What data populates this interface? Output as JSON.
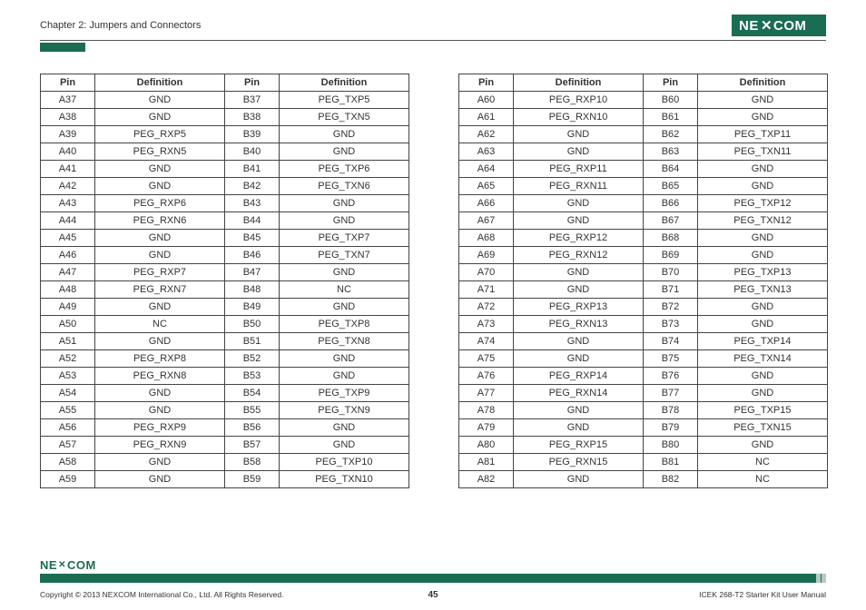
{
  "header": {
    "chapter": "Chapter 2: Jumpers and Connectors",
    "logo_text": "NEXCOM"
  },
  "columns": {
    "pin": "Pin",
    "definition": "Definition"
  },
  "table_left": [
    {
      "pa": "A37",
      "da": "GND",
      "pb": "B37",
      "db": "PEG_TXP5"
    },
    {
      "pa": "A38",
      "da": "GND",
      "pb": "B38",
      "db": "PEG_TXN5"
    },
    {
      "pa": "A39",
      "da": "PEG_RXP5",
      "pb": "B39",
      "db": "GND"
    },
    {
      "pa": "A40",
      "da": "PEG_RXN5",
      "pb": "B40",
      "db": "GND"
    },
    {
      "pa": "A41",
      "da": "GND",
      "pb": "B41",
      "db": "PEG_TXP6"
    },
    {
      "pa": "A42",
      "da": "GND",
      "pb": "B42",
      "db": "PEG_TXN6"
    },
    {
      "pa": "A43",
      "da": "PEG_RXP6",
      "pb": "B43",
      "db": "GND"
    },
    {
      "pa": "A44",
      "da": "PEG_RXN6",
      "pb": "B44",
      "db": "GND"
    },
    {
      "pa": "A45",
      "da": "GND",
      "pb": "B45",
      "db": "PEG_TXP7"
    },
    {
      "pa": "A46",
      "da": "GND",
      "pb": "B46",
      "db": "PEG_TXN7"
    },
    {
      "pa": "A47",
      "da": "PEG_RXP7",
      "pb": "B47",
      "db": "GND"
    },
    {
      "pa": "A48",
      "da": "PEG_RXN7",
      "pb": "B48",
      "db": "NC"
    },
    {
      "pa": "A49",
      "da": "GND",
      "pb": "B49",
      "db": "GND"
    },
    {
      "pa": "A50",
      "da": "NC",
      "pb": "B50",
      "db": "PEG_TXP8"
    },
    {
      "pa": "A51",
      "da": "GND",
      "pb": "B51",
      "db": "PEG_TXN8"
    },
    {
      "pa": "A52",
      "da": "PEG_RXP8",
      "pb": "B52",
      "db": "GND"
    },
    {
      "pa": "A53",
      "da": "PEG_RXN8",
      "pb": "B53",
      "db": "GND"
    },
    {
      "pa": "A54",
      "da": "GND",
      "pb": "B54",
      "db": "PEG_TXP9"
    },
    {
      "pa": "A55",
      "da": "GND",
      "pb": "B55",
      "db": "PEG_TXN9"
    },
    {
      "pa": "A56",
      "da": "PEG_RXP9",
      "pb": "B56",
      "db": "GND"
    },
    {
      "pa": "A57",
      "da": "PEG_RXN9",
      "pb": "B57",
      "db": "GND"
    },
    {
      "pa": "A58",
      "da": "GND",
      "pb": "B58",
      "db": "PEG_TXP10"
    },
    {
      "pa": "A59",
      "da": "GND",
      "pb": "B59",
      "db": "PEG_TXN10"
    }
  ],
  "table_right": [
    {
      "pa": "A60",
      "da": "PEG_RXP10",
      "pb": "B60",
      "db": "GND"
    },
    {
      "pa": "A61",
      "da": "PEG_RXN10",
      "pb": "B61",
      "db": "GND"
    },
    {
      "pa": "A62",
      "da": "GND",
      "pb": "B62",
      "db": "PEG_TXP11"
    },
    {
      "pa": "A63",
      "da": "GND",
      "pb": "B63",
      "db": "PEG_TXN11"
    },
    {
      "pa": "A64",
      "da": "PEG_RXP11",
      "pb": "B64",
      "db": "GND"
    },
    {
      "pa": "A65",
      "da": "PEG_RXN11",
      "pb": "B65",
      "db": "GND"
    },
    {
      "pa": "A66",
      "da": "GND",
      "pb": "B66",
      "db": "PEG_TXP12"
    },
    {
      "pa": "A67",
      "da": "GND",
      "pb": "B67",
      "db": "PEG_TXN12"
    },
    {
      "pa": "A68",
      "da": "PEG_RXP12",
      "pb": "B68",
      "db": "GND"
    },
    {
      "pa": "A69",
      "da": "PEG_RXN12",
      "pb": "B69",
      "db": "GND"
    },
    {
      "pa": "A70",
      "da": "GND",
      "pb": "B70",
      "db": "PEG_TXP13"
    },
    {
      "pa": "A71",
      "da": "GND",
      "pb": "B71",
      "db": "PEG_TXN13"
    },
    {
      "pa": "A72",
      "da": "PEG_RXP13",
      "pb": "B72",
      "db": "GND"
    },
    {
      "pa": "A73",
      "da": "PEG_RXN13",
      "pb": "B73",
      "db": "GND"
    },
    {
      "pa": "A74",
      "da": "GND",
      "pb": "B74",
      "db": "PEG_TXP14"
    },
    {
      "pa": "A75",
      "da": "GND",
      "pb": "B75",
      "db": "PEG_TXN14"
    },
    {
      "pa": "A76",
      "da": "PEG_RXP14",
      "pb": "B76",
      "db": "GND"
    },
    {
      "pa": "A77",
      "da": "PEG_RXN14",
      "pb": "B77",
      "db": "GND"
    },
    {
      "pa": "A78",
      "da": "GND",
      "pb": "B78",
      "db": "PEG_TXP15"
    },
    {
      "pa": "A79",
      "da": "GND",
      "pb": "B79",
      "db": "PEG_TXN15"
    },
    {
      "pa": "A80",
      "da": "PEG_RXP15",
      "pb": "B80",
      "db": "GND"
    },
    {
      "pa": "A81",
      "da": "PEG_RXN15",
      "pb": "B81",
      "db": "NC"
    },
    {
      "pa": "A82",
      "da": "GND",
      "pb": "B82",
      "db": "NC"
    }
  ],
  "footer": {
    "logo_text": "NEXCOM",
    "copyright": "Copyright © 2013 NEXCOM International Co., Ltd. All Rights Reserved.",
    "page": "45",
    "doc": "ICEK 268-T2 Starter Kit User Manual"
  }
}
